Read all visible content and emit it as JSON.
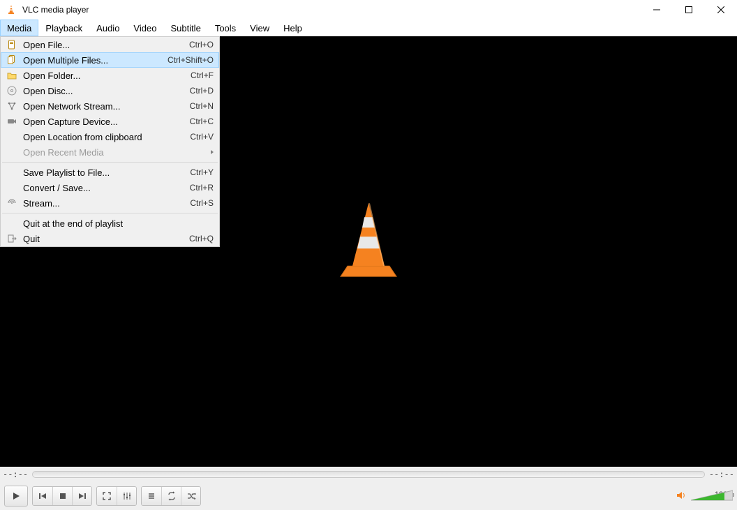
{
  "window": {
    "title": "VLC media player"
  },
  "menubar": [
    "Media",
    "Playback",
    "Audio",
    "Video",
    "Subtitle",
    "Tools",
    "View",
    "Help"
  ],
  "active_menu": 0,
  "media_menu": {
    "highlighted": 1,
    "items": [
      {
        "type": "item",
        "icon": "file",
        "label": "Open File...",
        "shortcut": "Ctrl+O"
      },
      {
        "type": "item",
        "icon": "files",
        "label": "Open Multiple Files...",
        "shortcut": "Ctrl+Shift+O"
      },
      {
        "type": "item",
        "icon": "folder",
        "label": "Open Folder...",
        "shortcut": "Ctrl+F"
      },
      {
        "type": "item",
        "icon": "disc",
        "label": "Open Disc...",
        "shortcut": "Ctrl+D"
      },
      {
        "type": "item",
        "icon": "network",
        "label": "Open Network Stream...",
        "shortcut": "Ctrl+N"
      },
      {
        "type": "item",
        "icon": "capture",
        "label": "Open Capture Device...",
        "shortcut": "Ctrl+C"
      },
      {
        "type": "item",
        "icon": "",
        "label": "Open Location from clipboard",
        "shortcut": "Ctrl+V"
      },
      {
        "type": "item",
        "icon": "",
        "label": "Open Recent Media",
        "shortcut": "",
        "disabled": true,
        "submenu": true
      },
      {
        "type": "sep"
      },
      {
        "type": "item",
        "icon": "",
        "label": "Save Playlist to File...",
        "shortcut": "Ctrl+Y"
      },
      {
        "type": "item",
        "icon": "",
        "label": "Convert / Save...",
        "shortcut": "Ctrl+R"
      },
      {
        "type": "item",
        "icon": "stream",
        "label": "Stream...",
        "shortcut": "Ctrl+S"
      },
      {
        "type": "sep"
      },
      {
        "type": "item",
        "icon": "",
        "label": "Quit at the end of playlist",
        "shortcut": ""
      },
      {
        "type": "item",
        "icon": "quit",
        "label": "Quit",
        "shortcut": "Ctrl+Q"
      }
    ]
  },
  "seek": {
    "elapsed": "--:--",
    "total": "--:--"
  },
  "volume": {
    "percent_label": "100%",
    "value": 100
  },
  "buttons": {
    "play": "play",
    "prev": "prev",
    "stop": "stop",
    "next": "next",
    "fullscreen": "fullscreen",
    "ext": "extended-settings",
    "playlist": "playlist",
    "loop": "loop",
    "shuffle": "shuffle"
  }
}
